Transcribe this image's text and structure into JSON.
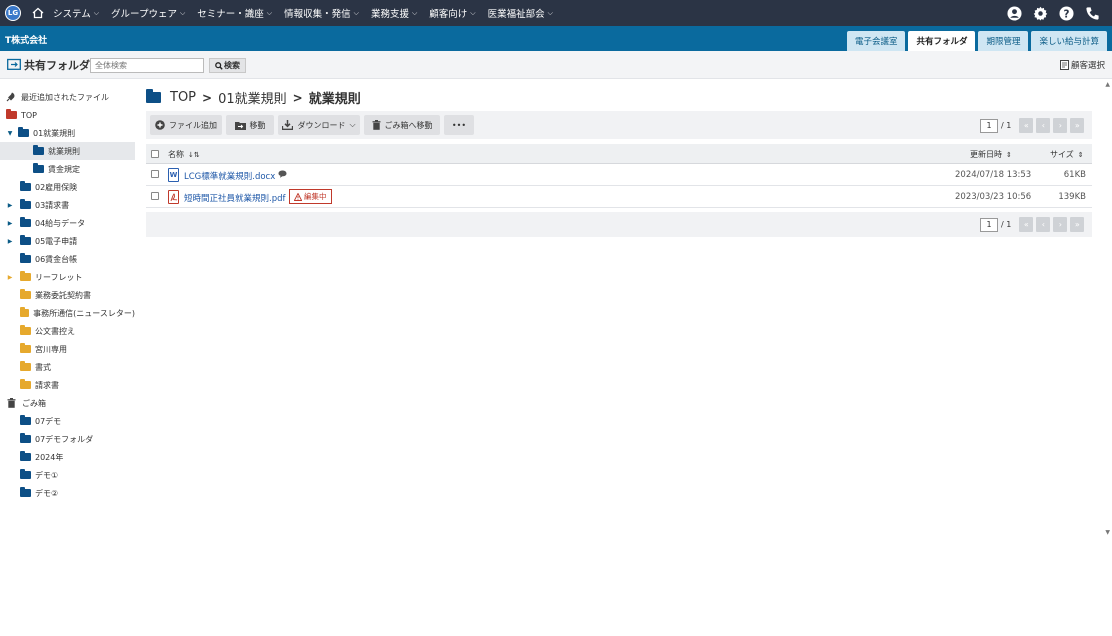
{
  "nav": {
    "logo": "LG",
    "items": [
      "システム",
      "グループウェア",
      "セミナー・識座",
      "情報収集・発信",
      "業務支援",
      "顧客向け",
      "医業福祉部会"
    ],
    "chevron": "⌵"
  },
  "company": {
    "name": "T株式会社"
  },
  "tabs": [
    "電子会議室",
    "共有フォルダ",
    "期限管理",
    "楽しい給与計算"
  ],
  "header": {
    "title": "共有フォルダ",
    "search_placeholder": "全体検索",
    "search_button": "検索",
    "client_select": "顧客選択"
  },
  "sidebar": {
    "recent": "最近追加されたファイル",
    "items": [
      {
        "label": "TOP"
      },
      {
        "label": "01就業規則"
      },
      {
        "label": "就業規則"
      },
      {
        "label": "賃金規定"
      },
      {
        "label": "02雇用保険"
      },
      {
        "label": "03請求書"
      },
      {
        "label": "04給与データ"
      },
      {
        "label": "05電子申請"
      },
      {
        "label": "06賃金台帳"
      },
      {
        "label": "リーフレット"
      },
      {
        "label": "業務委託契約書"
      },
      {
        "label": "事務所通信(ニュースレター)"
      },
      {
        "label": "公文書控え"
      },
      {
        "label": "宮川専用"
      },
      {
        "label": "書式"
      },
      {
        "label": "請求書"
      },
      {
        "label": "ごみ箱"
      },
      {
        "label": "07デモ"
      },
      {
        "label": "07デモフォルダ"
      },
      {
        "label": "2024年"
      },
      {
        "label": "デモ①"
      },
      {
        "label": "デモ②"
      }
    ]
  },
  "breadcrumb": {
    "root": "TOP",
    "sep": ">",
    "level1": "01就業規則",
    "current": "就業規則"
  },
  "toolbar": {
    "add_file": "ファイル追加",
    "move": "移動",
    "download": "ダウンロード",
    "trash": "ごみ箱へ移動",
    "more": "•••"
  },
  "pager": {
    "page": "1",
    "total": "/ 1",
    "first": "«",
    "prev": "‹",
    "next": "›",
    "last": "»"
  },
  "table": {
    "headers": {
      "name": "名称",
      "updated": "更新日時",
      "size": "サイズ"
    },
    "rows": [
      {
        "icon": "W",
        "name": "LCG標準就業規則.docx",
        "updated": "2024/07/18 13:53",
        "size": "61KB"
      },
      {
        "icon": "PDF",
        "name": "短時間正社員就業規則.pdf",
        "badge": "編集中",
        "updated": "2023/03/23 10:56",
        "size": "139KB"
      }
    ]
  },
  "colors": {
    "topnav": "#2b3445",
    "brand": "#0a6a9e",
    "folder": "#0d4f86",
    "folder_alt": "#e6a92d",
    "danger": "#c0392b"
  }
}
